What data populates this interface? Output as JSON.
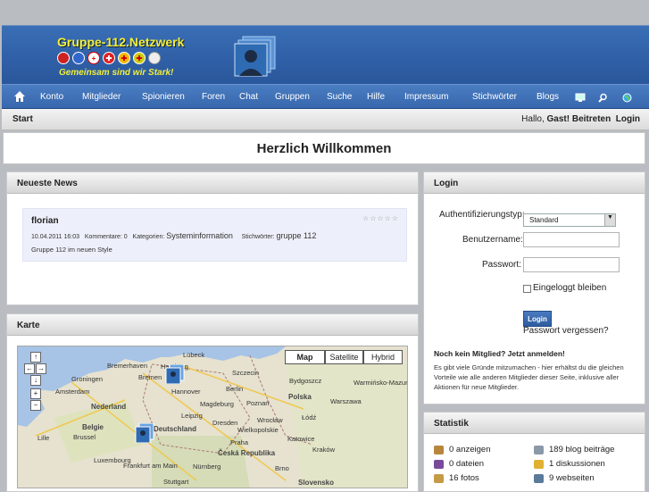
{
  "header": {
    "logo_title": "Gruppe-112.Netzwerk",
    "logo_slogan": "Gemeinsam sind wir Stark!"
  },
  "nav": {
    "items": [
      "Konto",
      "Mitglieder",
      "Spionieren",
      "Foren",
      "Chat",
      "Gruppen",
      "Suche",
      "Hilfe",
      "Impressum",
      "Stichwörter",
      "Blogs"
    ]
  },
  "breadcrumb": {
    "start": "Start",
    "greeting": "Hallo,",
    "guest": "Gast!",
    "join": "Beitreten",
    "login": "Login"
  },
  "welcome": "Herzlich Willkommen",
  "news": {
    "title": "Neueste News",
    "author": "florian",
    "date": "10.04.2011 16:03",
    "comments": "Kommentare: 0",
    "cat_label": "Kategorien:",
    "category": "Systeminformation",
    "tag_label": "Stichwörter:",
    "tag": "gruppe 112",
    "body": "Gruppe 112 im neuen Style",
    "stars": "☆☆☆☆☆"
  },
  "map": {
    "title": "Karte",
    "types": [
      "Map",
      "Satellite",
      "Hybrid"
    ],
    "cities": [
      "Lübeck",
      "Bremerhaven",
      "Hamburg",
      "Szczecin",
      "Bremen",
      "Groningen",
      "Hannover",
      "Berlin",
      "Bydgoszcz",
      "Amsterdam",
      "Nederland",
      "Magdeburg",
      "Poznań",
      "Polska",
      "Warszawa",
      "Leipzig",
      "Dresden",
      "Wrocław",
      "Łódź",
      "Belgie",
      "Brussel",
      "Lille",
      "Luxembourg",
      "Frankfurt am Main",
      "Praha",
      "Česká Republika",
      "Nürnberg",
      "Stuttgart",
      "Brno",
      "Slovensko",
      "Katowice",
      "Kraków",
      "Deutschland",
      "Wielkopolskie",
      "Warmińsko-Mazurskie"
    ]
  },
  "login": {
    "title": "Login",
    "auth_label": "Authentifizierungstyp:",
    "auth_value": "Standard",
    "user_label": "Benutzername:",
    "pass_label": "Passwort:",
    "remember": "Eingeloggt bleiben",
    "button": "Login",
    "forgot": "Passwort vergessen?",
    "notmember": "Noch kein Mitglied? Jetzt anmelden!",
    "notmember_text": "Es gibt viele Gründe mitzumachen - hier erhältst du die gleichen Vorteile wie alle anderen Mitglieder dieser Seite, inklusive aller Aktionen für neue Mitglieder."
  },
  "stats": {
    "title": "Statistik",
    "items": [
      "0 anzeigen",
      "189 blog beiträge",
      "0 dateien",
      "1 diskussionen",
      "16 fotos",
      "9 webseiten"
    ]
  }
}
